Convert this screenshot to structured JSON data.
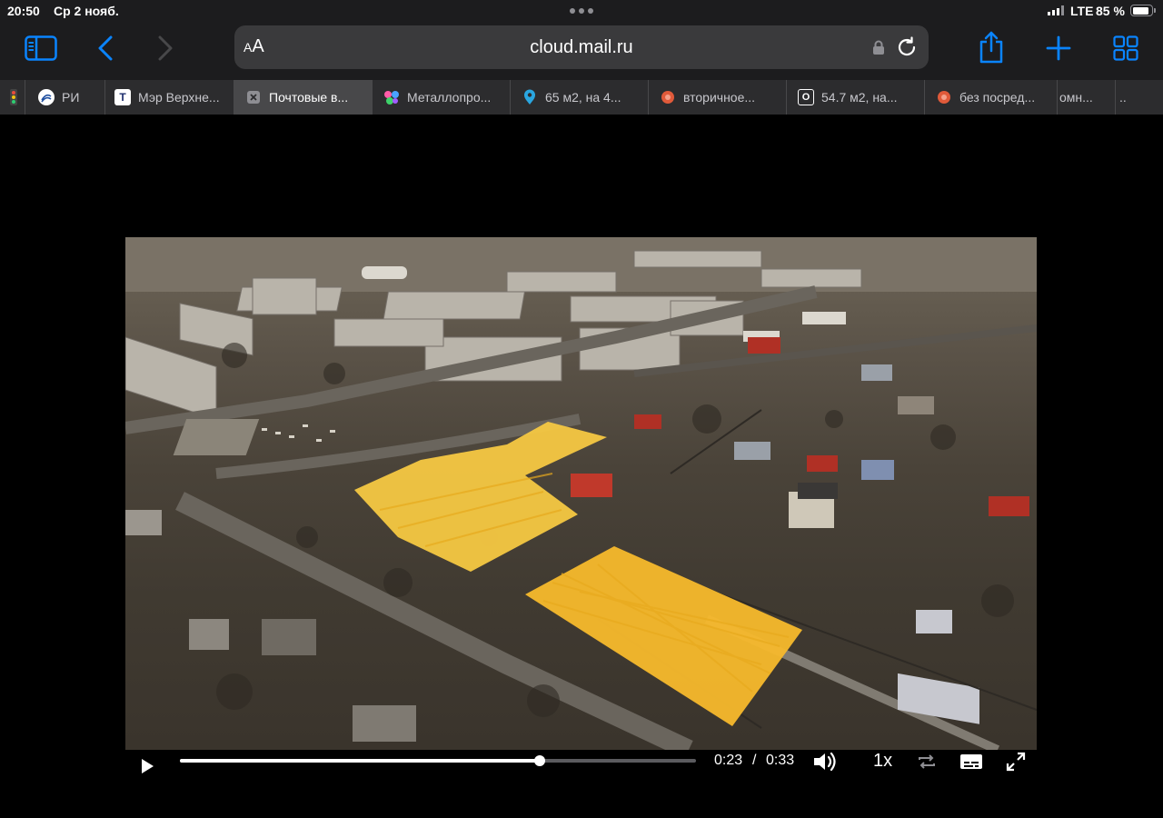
{
  "status_bar": {
    "time": "20:50",
    "date": "Ср 2 нояб.",
    "network": "LTE",
    "battery": "85 %",
    "battery_level_percent": 85
  },
  "toolbar": {
    "aa_small": "A",
    "aa_large": "A",
    "url": "cloud.mail.ru",
    "accent_color": "#0a84ff"
  },
  "tabs": [
    {
      "label": "",
      "favicon": "traffic-light-icon"
    },
    {
      "label": "РИ",
      "favicon": "ri-icon"
    },
    {
      "label": "Мэр Верхне...",
      "favicon": "t-icon"
    },
    {
      "label": "Почтовые в...",
      "favicon": "close-icon"
    },
    {
      "label": "Металлопро...",
      "favicon": "colored-dots-icon"
    },
    {
      "label": "65 м2, на 4...",
      "favicon": "pin-icon"
    },
    {
      "label": "вторичное...",
      "favicon": "avito-icon"
    },
    {
      "label": "54.7 м2, на...",
      "favicon": "o-icon"
    },
    {
      "label": "без посред...",
      "favicon": "avito-icon"
    },
    {
      "label": "омн...",
      "favicon": ""
    },
    {
      "label": "..",
      "favicon": ""
    }
  ],
  "video": {
    "current_time": "0:23",
    "separator": "/",
    "duration": "0:33",
    "progress_fraction": 0.697,
    "speed": "1x",
    "highlight_color": "#f5c842"
  }
}
